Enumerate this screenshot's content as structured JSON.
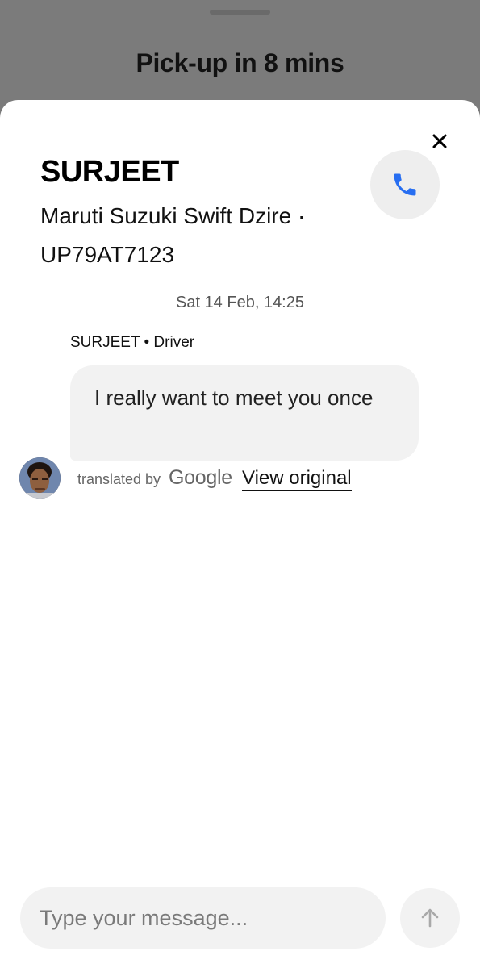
{
  "header": {
    "title": "Pick-up in 8 mins"
  },
  "driver": {
    "name": "SURJEET",
    "car_model": "Maruti Suzuki Swift Dzire ·",
    "plate": "UP79AT7123"
  },
  "chat": {
    "timestamp": "Sat 14 Feb, 14:25",
    "sender": "SURJEET • Driver",
    "message": "I really want to meet you once",
    "translated_by": "translated by",
    "translation_provider": "Google",
    "view_original": "View original"
  },
  "composer": {
    "placeholder": "Type your message..."
  },
  "icons": {
    "close": "close-icon",
    "phone": "phone-icon",
    "send": "arrow-up-icon"
  },
  "colors": {
    "phone_icon": "#276ef1",
    "backdrop": "#7b7b7b",
    "bubble": "#f2f2f2"
  }
}
